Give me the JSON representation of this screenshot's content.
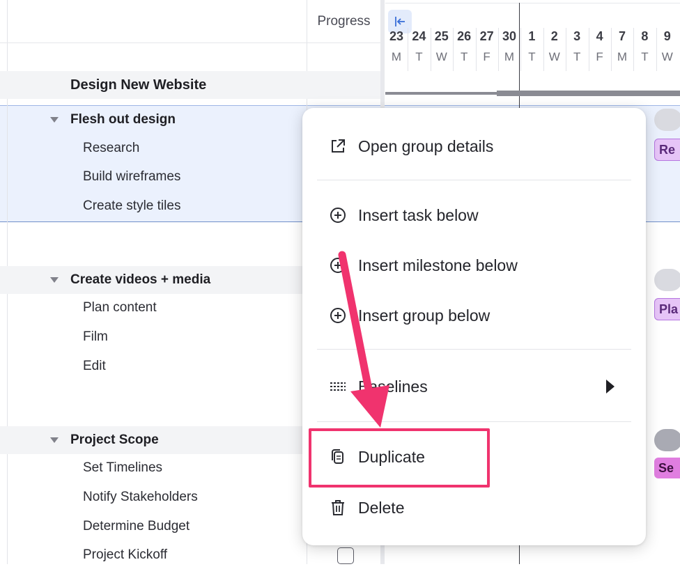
{
  "columns": {
    "progress": "Progress"
  },
  "timeline": {
    "days": [
      {
        "num": "23",
        "dow": "M"
      },
      {
        "num": "24",
        "dow": "T"
      },
      {
        "num": "25",
        "dow": "W"
      },
      {
        "num": "26",
        "dow": "T"
      },
      {
        "num": "27",
        "dow": "F"
      },
      {
        "num": "30",
        "dow": "M"
      },
      {
        "num": "1",
        "dow": "T"
      },
      {
        "num": "2",
        "dow": "W"
      },
      {
        "num": "3",
        "dow": "T"
      },
      {
        "num": "4",
        "dow": "F"
      },
      {
        "num": "7",
        "dow": "M"
      },
      {
        "num": "8",
        "dow": "T"
      },
      {
        "num": "9",
        "dow": "W"
      }
    ],
    "tags": [
      "Re",
      "Pla",
      "Se"
    ]
  },
  "rows": {
    "project": "Design New Website",
    "group1": "Flesh out design",
    "g1_tasks": [
      "Research",
      "Build wireframes",
      "Create style tiles"
    ],
    "group2": "Create videos + media",
    "g2_tasks": [
      "Plan content",
      "Film",
      "Edit"
    ],
    "group3": "Project Scope",
    "g3_tasks": [
      "Set Timelines",
      "Notify Stakeholders",
      "Determine Budget",
      "Project Kickoff"
    ]
  },
  "menu": {
    "items": [
      {
        "label": "Open group details",
        "icon": "external-link-icon"
      },
      {
        "label": "Insert task below",
        "icon": "plus-circle-icon"
      },
      {
        "label": "Insert milestone below",
        "icon": "plus-circle-icon"
      },
      {
        "label": "Insert group below",
        "icon": "plus-circle-icon"
      },
      {
        "label": "Baselines",
        "icon": "baselines-icon"
      },
      {
        "label": "Duplicate",
        "icon": "duplicate-icon"
      },
      {
        "label": "Delete",
        "icon": "trash-icon"
      }
    ]
  },
  "colors": {
    "accent_pink": "#f0336e",
    "selected_bg": "#ebf1fd",
    "tag_purple": "#e6c4f7",
    "tag_magenta": "#e07ee0"
  }
}
